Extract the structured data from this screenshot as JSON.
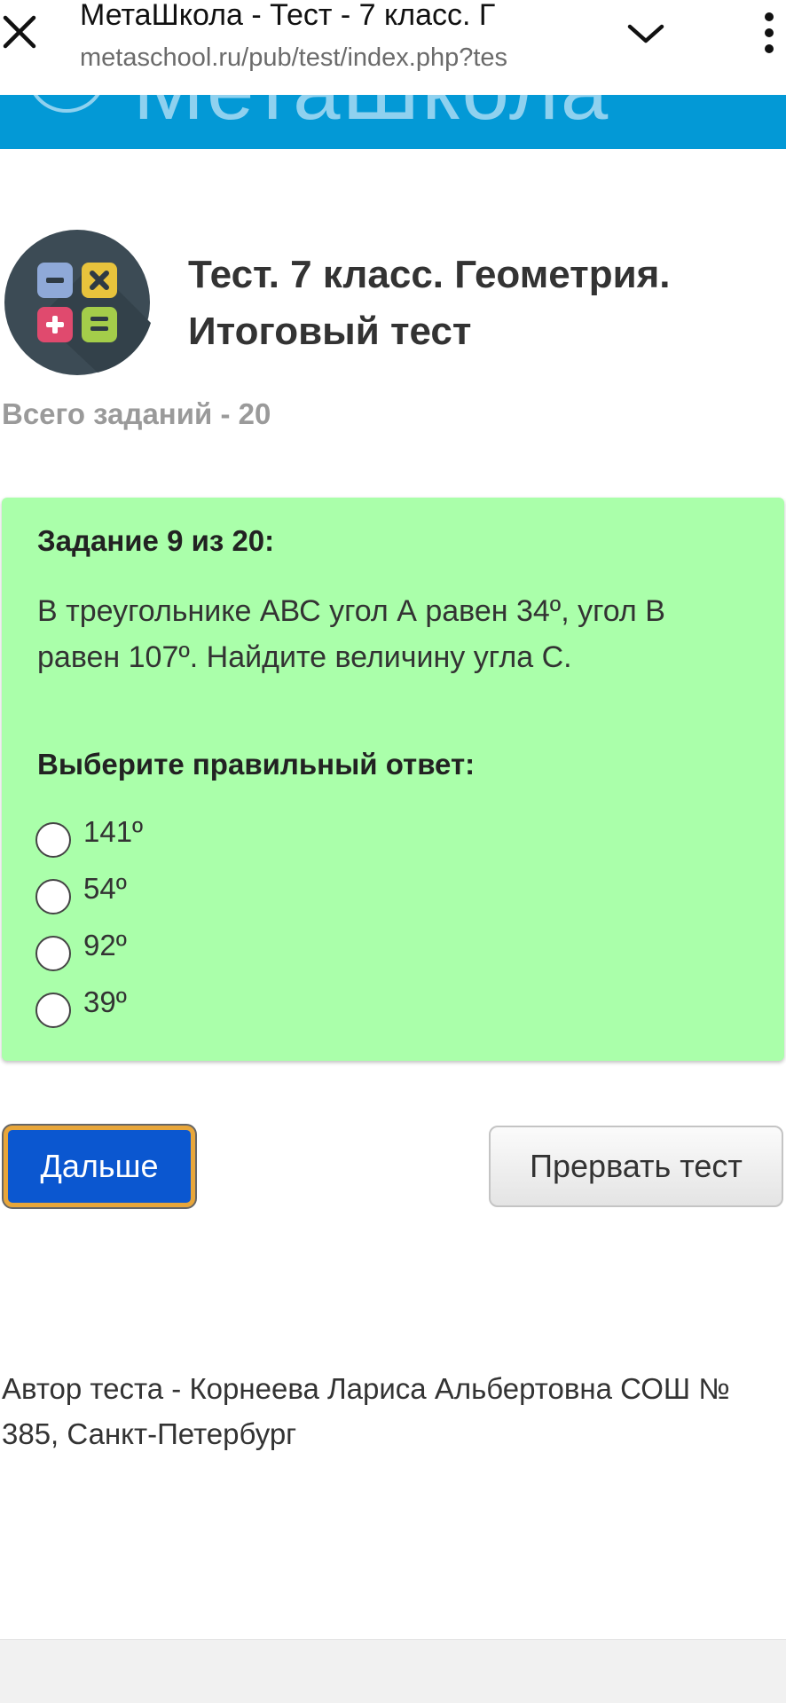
{
  "browser": {
    "title": "МетаШкола - Тест - 7 класс. Г",
    "url": "metaschool.ru/pub/test/index.php?tes",
    "close_icon": "close-icon",
    "dropdown_icon": "chevron-down-icon",
    "menu_icon": "more-vert-icon"
  },
  "banner": {
    "site_name": "МетаШкола",
    "color": "#0399d6"
  },
  "header": {
    "title": "Тест. 7 класс. Геометрия. Итоговый тест",
    "total_tasks": "Всего заданий - 20"
  },
  "question": {
    "heading": "Задание 9 из 20:",
    "text": "В треугольнике АВС угол А равен 34º, угол В равен 107º. Найдите величину угла С.",
    "prompt": "Выберите правильный ответ:",
    "options": [
      {
        "label": "141º"
      },
      {
        "label": "54º"
      },
      {
        "label": "92º"
      },
      {
        "label": "39º"
      }
    ],
    "card_color": "#aaffaa"
  },
  "buttons": {
    "next_label": "Дальше",
    "abort_label": "Прервать тест"
  },
  "footer": {
    "author": "Автор теста - Корнеева Лариса Альбертовна СОШ № 385, Санкт-Петербург"
  }
}
